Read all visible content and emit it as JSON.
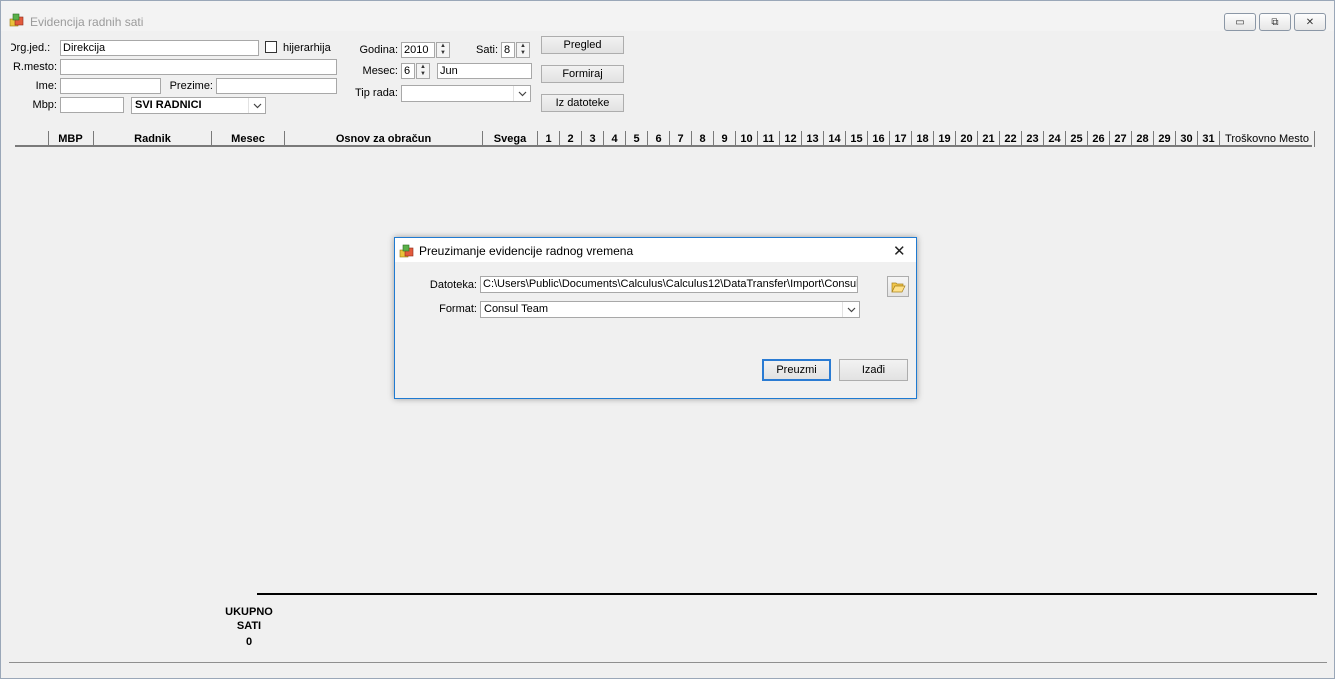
{
  "window": {
    "title": "Evidencija radnih sati",
    "minimize_label": "▭",
    "maximize_label": "⧉",
    "close_label": "✕"
  },
  "filters": {
    "org_jed_label": "Org.jed.:",
    "org_jed_value": "Direkcija",
    "hijerarhija_label": "hijerarhija",
    "rmesto_label": "R.mesto:",
    "rmesto_value": "",
    "ime_label": "Ime:",
    "ime_value": "",
    "prezime_label": "Prezime:",
    "prezime_value": "",
    "mbp_label": "Mbp:",
    "mbp_value": "",
    "radnici_select": "SVI RADNICI",
    "godina_label": "Godina:",
    "godina_value": "2010",
    "sati_label": "Sati:",
    "sati_value": "8",
    "mesec_label": "Mesec:",
    "mesec_value": "6",
    "mesec_name": "Jun",
    "tip_rada_label": "Tip rada:",
    "tip_rada_value": ""
  },
  "actions": {
    "pregled": "Pregled",
    "formiraj": "Formiraj",
    "iz_datoteke": "Iz datoteke"
  },
  "grid": {
    "columns": [
      "MBP",
      "Radnik",
      "Mesec",
      "Osnov za obračun",
      "Svega",
      "1",
      "2",
      "3",
      "4",
      "5",
      "6",
      "7",
      "8",
      "9",
      "10",
      "11",
      "12",
      "13",
      "14",
      "15",
      "16",
      "17",
      "18",
      "19",
      "20",
      "21",
      "22",
      "23",
      "24",
      "25",
      "26",
      "27",
      "28",
      "29",
      "30",
      "31",
      "Troškovno Mesto"
    ]
  },
  "totals": {
    "line1": "UKUPNO",
    "line2": "SATI",
    "value": "0"
  },
  "dialog": {
    "title": "Preuzimanje evidencije radnog vremena",
    "datoteka_label": "Datoteka:",
    "datoteka_value": "C:\\Users\\Public\\Documents\\Calculus\\Calculus12\\DataTransfer\\Import\\Consul team",
    "format_label": "Format:",
    "format_value": "Consul Team",
    "preuzmi": "Preuzmi",
    "izadji": "Izađi",
    "close": "✕"
  },
  "icons": {
    "app": "app-logo-icon",
    "folder": "folder-open-icon"
  }
}
